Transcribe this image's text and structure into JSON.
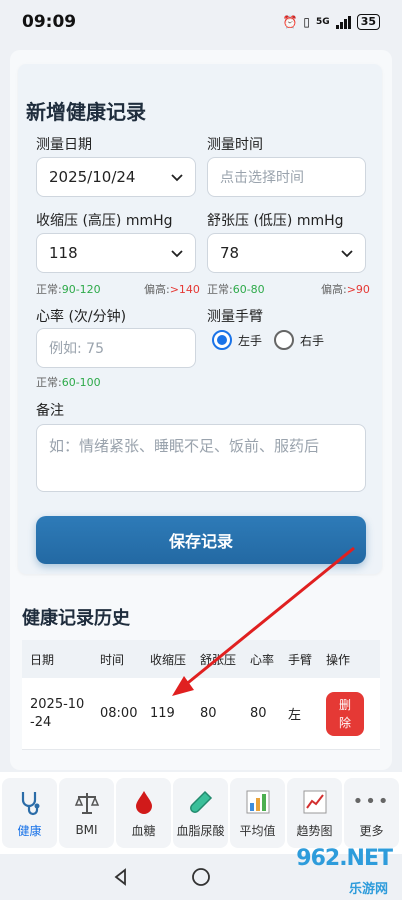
{
  "status_bar": {
    "time": "09:09",
    "network": "5G",
    "battery": "35"
  },
  "form": {
    "title": "新增健康记录",
    "date": {
      "label": "测量日期",
      "value": "2025/10/24"
    },
    "time": {
      "label": "测量时间",
      "placeholder": "点击选择时间"
    },
    "systolic": {
      "label": "收缩压 (高压) mmHg",
      "value": "118",
      "hint_normal_label": "正常:",
      "hint_normal": "90-120",
      "hint_high_label": "偏高:",
      "hint_high": ">140"
    },
    "diastolic": {
      "label": "舒张压 (低压) mmHg",
      "value": "78",
      "hint_normal_label": "正常:",
      "hint_normal": "60-80",
      "hint_high_label": "偏高:",
      "hint_high": ">90"
    },
    "heart_rate": {
      "label": "心率 (次/分钟)",
      "placeholder": "例如: 75",
      "hint_normal_label": "正常:",
      "hint_normal": "60-100"
    },
    "arm": {
      "label": "测量手臂",
      "left": "左手",
      "right": "右手",
      "selected": "left"
    },
    "notes": {
      "label": "备注",
      "placeholder": "如：情绪紧张、睡眠不足、饭前、服药后"
    },
    "save_label": "保存记录"
  },
  "history": {
    "title": "健康记录历史",
    "columns": [
      "日期",
      "时间",
      "收缩压",
      "舒张压",
      "心率",
      "手臂",
      "操作"
    ],
    "rows": [
      {
        "date": "2025-10-24",
        "time": "08:00",
        "systolic": "119",
        "diastolic": "80",
        "heart_rate": "80",
        "arm": "左",
        "action": "删除"
      }
    ]
  },
  "bottom_nav": [
    {
      "label": "健康",
      "icon": "stethoscope-icon",
      "active": true
    },
    {
      "label": "BMI",
      "icon": "scale-icon",
      "active": false
    },
    {
      "label": "血糖",
      "icon": "blood-drop-icon",
      "active": false
    },
    {
      "label": "血脂尿酸",
      "icon": "test-tube-icon",
      "active": false
    },
    {
      "label": "平均值",
      "icon": "bar-chart-icon",
      "active": false
    },
    {
      "label": "趋势图",
      "icon": "line-chart-icon",
      "active": false
    },
    {
      "label": "更多",
      "icon": "more-icon",
      "active": false
    }
  ],
  "watermark": {
    "logo": "962.NET",
    "sub": "乐游网"
  },
  "colors": {
    "accent": "#2369a3",
    "danger": "#e53935",
    "normal": "#2eaa4a",
    "active_nav": "#1a73e8"
  }
}
